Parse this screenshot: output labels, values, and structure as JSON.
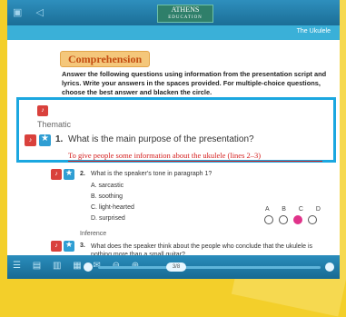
{
  "header": {
    "logo_title": "ATHENS",
    "logo_sub": "EDUCATION",
    "section_label": "The Ukulele"
  },
  "comprehension": {
    "title": "Comprehension",
    "instructions": "Answer the following questions using information from the presentation script and lyrics. Write your answers in the spaces provided. For multiple-choice questions, choose the best answer and blacken the circle."
  },
  "zoom": {
    "category": "Thematic",
    "q_number": "1.",
    "question": "What is the main purpose of the presentation?",
    "answer": "To give people some information about the ukulele (lines 2–3)"
  },
  "question2": {
    "number": "2.",
    "text": "What is the speaker's tone in paragraph 1?",
    "options": [
      "A.  sarcastic",
      "B.  soothing",
      "C.  light-hearted",
      "D.  surprised"
    ],
    "choice_letters": "A B C D",
    "selected": "C"
  },
  "question3": {
    "category": "Inference",
    "number": "3.",
    "text": "What does the speaker think about the people who conclude that the ukulele is nothing more than a small guitar?"
  },
  "toolbar": {
    "page_indicator": "3/8"
  }
}
